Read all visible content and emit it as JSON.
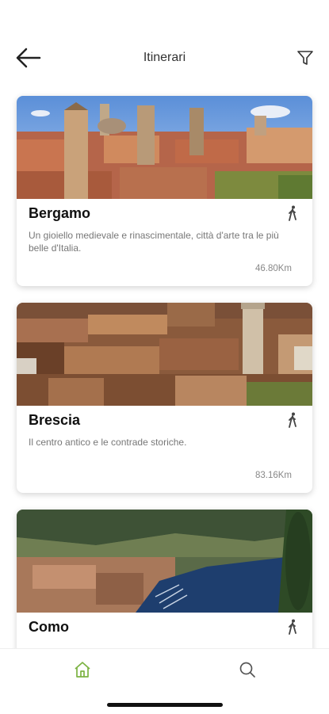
{
  "header": {
    "title": "Itinerari"
  },
  "itineraries": [
    {
      "name": "Bergamo",
      "description": "Un gioiello medievale e rinascimentale, città d'arte tra le più belle d'Italia.",
      "distance": "46.80Km"
    },
    {
      "name": "Brescia",
      "description": "Il centro antico e le contrade storiche.",
      "distance": "83.16Km"
    },
    {
      "name": "Como",
      "description": "",
      "distance": ""
    }
  ],
  "icons": {
    "back": "arrow-left-icon",
    "filter": "filter-icon",
    "walk": "walking-person-icon",
    "home": "home-icon",
    "search": "search-icon"
  },
  "colors": {
    "accent": "#7cb342",
    "icon": "#333333",
    "muted": "#777777"
  }
}
